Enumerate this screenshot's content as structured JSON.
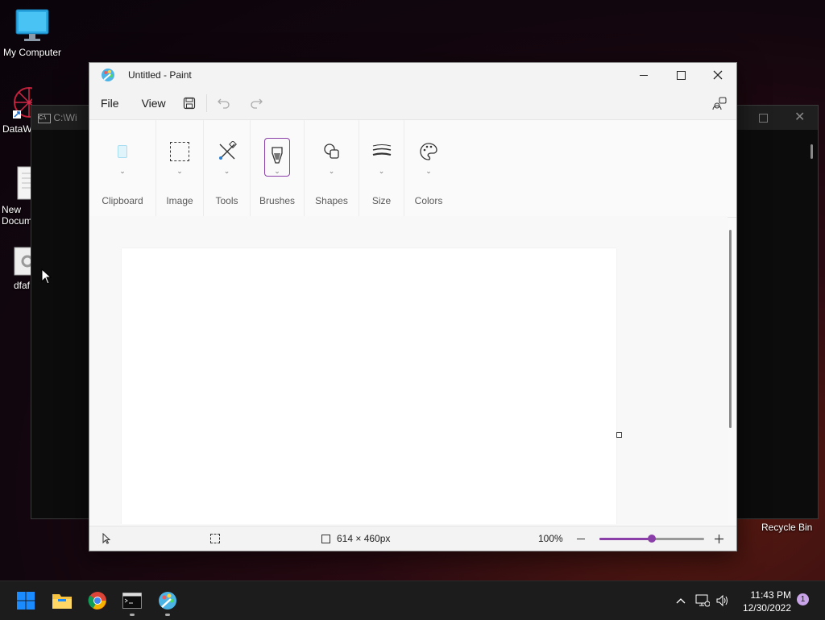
{
  "desktop": {
    "icons": [
      {
        "label": "My Computer"
      },
      {
        "label": "DataW"
      },
      {
        "label": "New Docum"
      },
      {
        "label": "dfaf"
      }
    ],
    "recycle_bin": "Recycle Bin",
    "console_title": "C:\\Wi"
  },
  "paint": {
    "title": "Untitled - Paint",
    "menu": {
      "file": "File",
      "view": "View"
    },
    "ribbon": {
      "groups": [
        {
          "label": "Clipboard"
        },
        {
          "label": "Image"
        },
        {
          "label": "Tools"
        },
        {
          "label": "Brushes"
        },
        {
          "label": "Shapes"
        },
        {
          "label": "Size"
        },
        {
          "label": "Colors"
        }
      ]
    },
    "status": {
      "canvas_size": "614 × 460px",
      "zoom": "100%",
      "zoom_fraction": 0.5
    }
  },
  "taskbar": {
    "time": "11:43 PM",
    "date": "12/30/2022",
    "notification_count": "1"
  },
  "colors": {
    "accent": "#8a3ea8",
    "windows_blue": "#1a8cff"
  }
}
